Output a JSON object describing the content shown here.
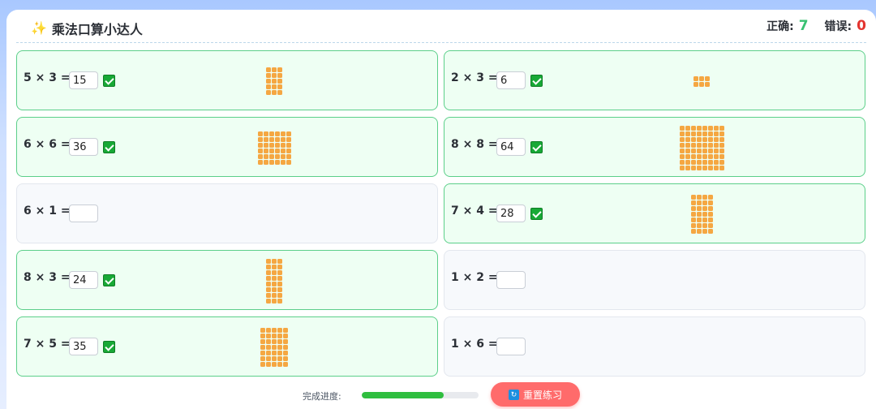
{
  "title": "乘法口算小达人",
  "title_icon": "sparkle-icon",
  "score": {
    "correct_label": "正确:",
    "correct_value": "7",
    "wrong_label": "错误:",
    "wrong_value": "0"
  },
  "questions": [
    {
      "expr": "5 × 3 =",
      "answer": "15",
      "done": true,
      "a": 5,
      "b": 3
    },
    {
      "expr": "2 × 3 =",
      "answer": "6",
      "done": true,
      "a": 2,
      "b": 3
    },
    {
      "expr": "6 × 6 =",
      "answer": "36",
      "done": true,
      "a": 6,
      "b": 6
    },
    {
      "expr": "8 × 8 =",
      "answer": "64",
      "done": true,
      "a": 8,
      "b": 8
    },
    {
      "expr": "6 × 1 =",
      "answer": "",
      "done": false,
      "a": 6,
      "b": 1
    },
    {
      "expr": "7 × 4 =",
      "answer": "28",
      "done": true,
      "a": 7,
      "b": 4
    },
    {
      "expr": "8 × 3 =",
      "answer": "24",
      "done": true,
      "a": 8,
      "b": 3
    },
    {
      "expr": "1 × 2 =",
      "answer": "",
      "done": false,
      "a": 1,
      "b": 2
    },
    {
      "expr": "7 × 5 =",
      "answer": "35",
      "done": true,
      "a": 7,
      "b": 5
    },
    {
      "expr": "1 × 6 =",
      "answer": "",
      "done": false,
      "a": 1,
      "b": 6
    }
  ],
  "footer": {
    "progress_label": "完成进度:",
    "progress_value": 0.7,
    "reset_label": "重置练习",
    "reset_icon": "refresh-icon"
  },
  "colors": {
    "correct": "#38c172",
    "wrong": "#e3342f",
    "dot": "#f5a742",
    "reset_button": "#ff6b6b",
    "progress_fill": "#2fbe3f"
  }
}
